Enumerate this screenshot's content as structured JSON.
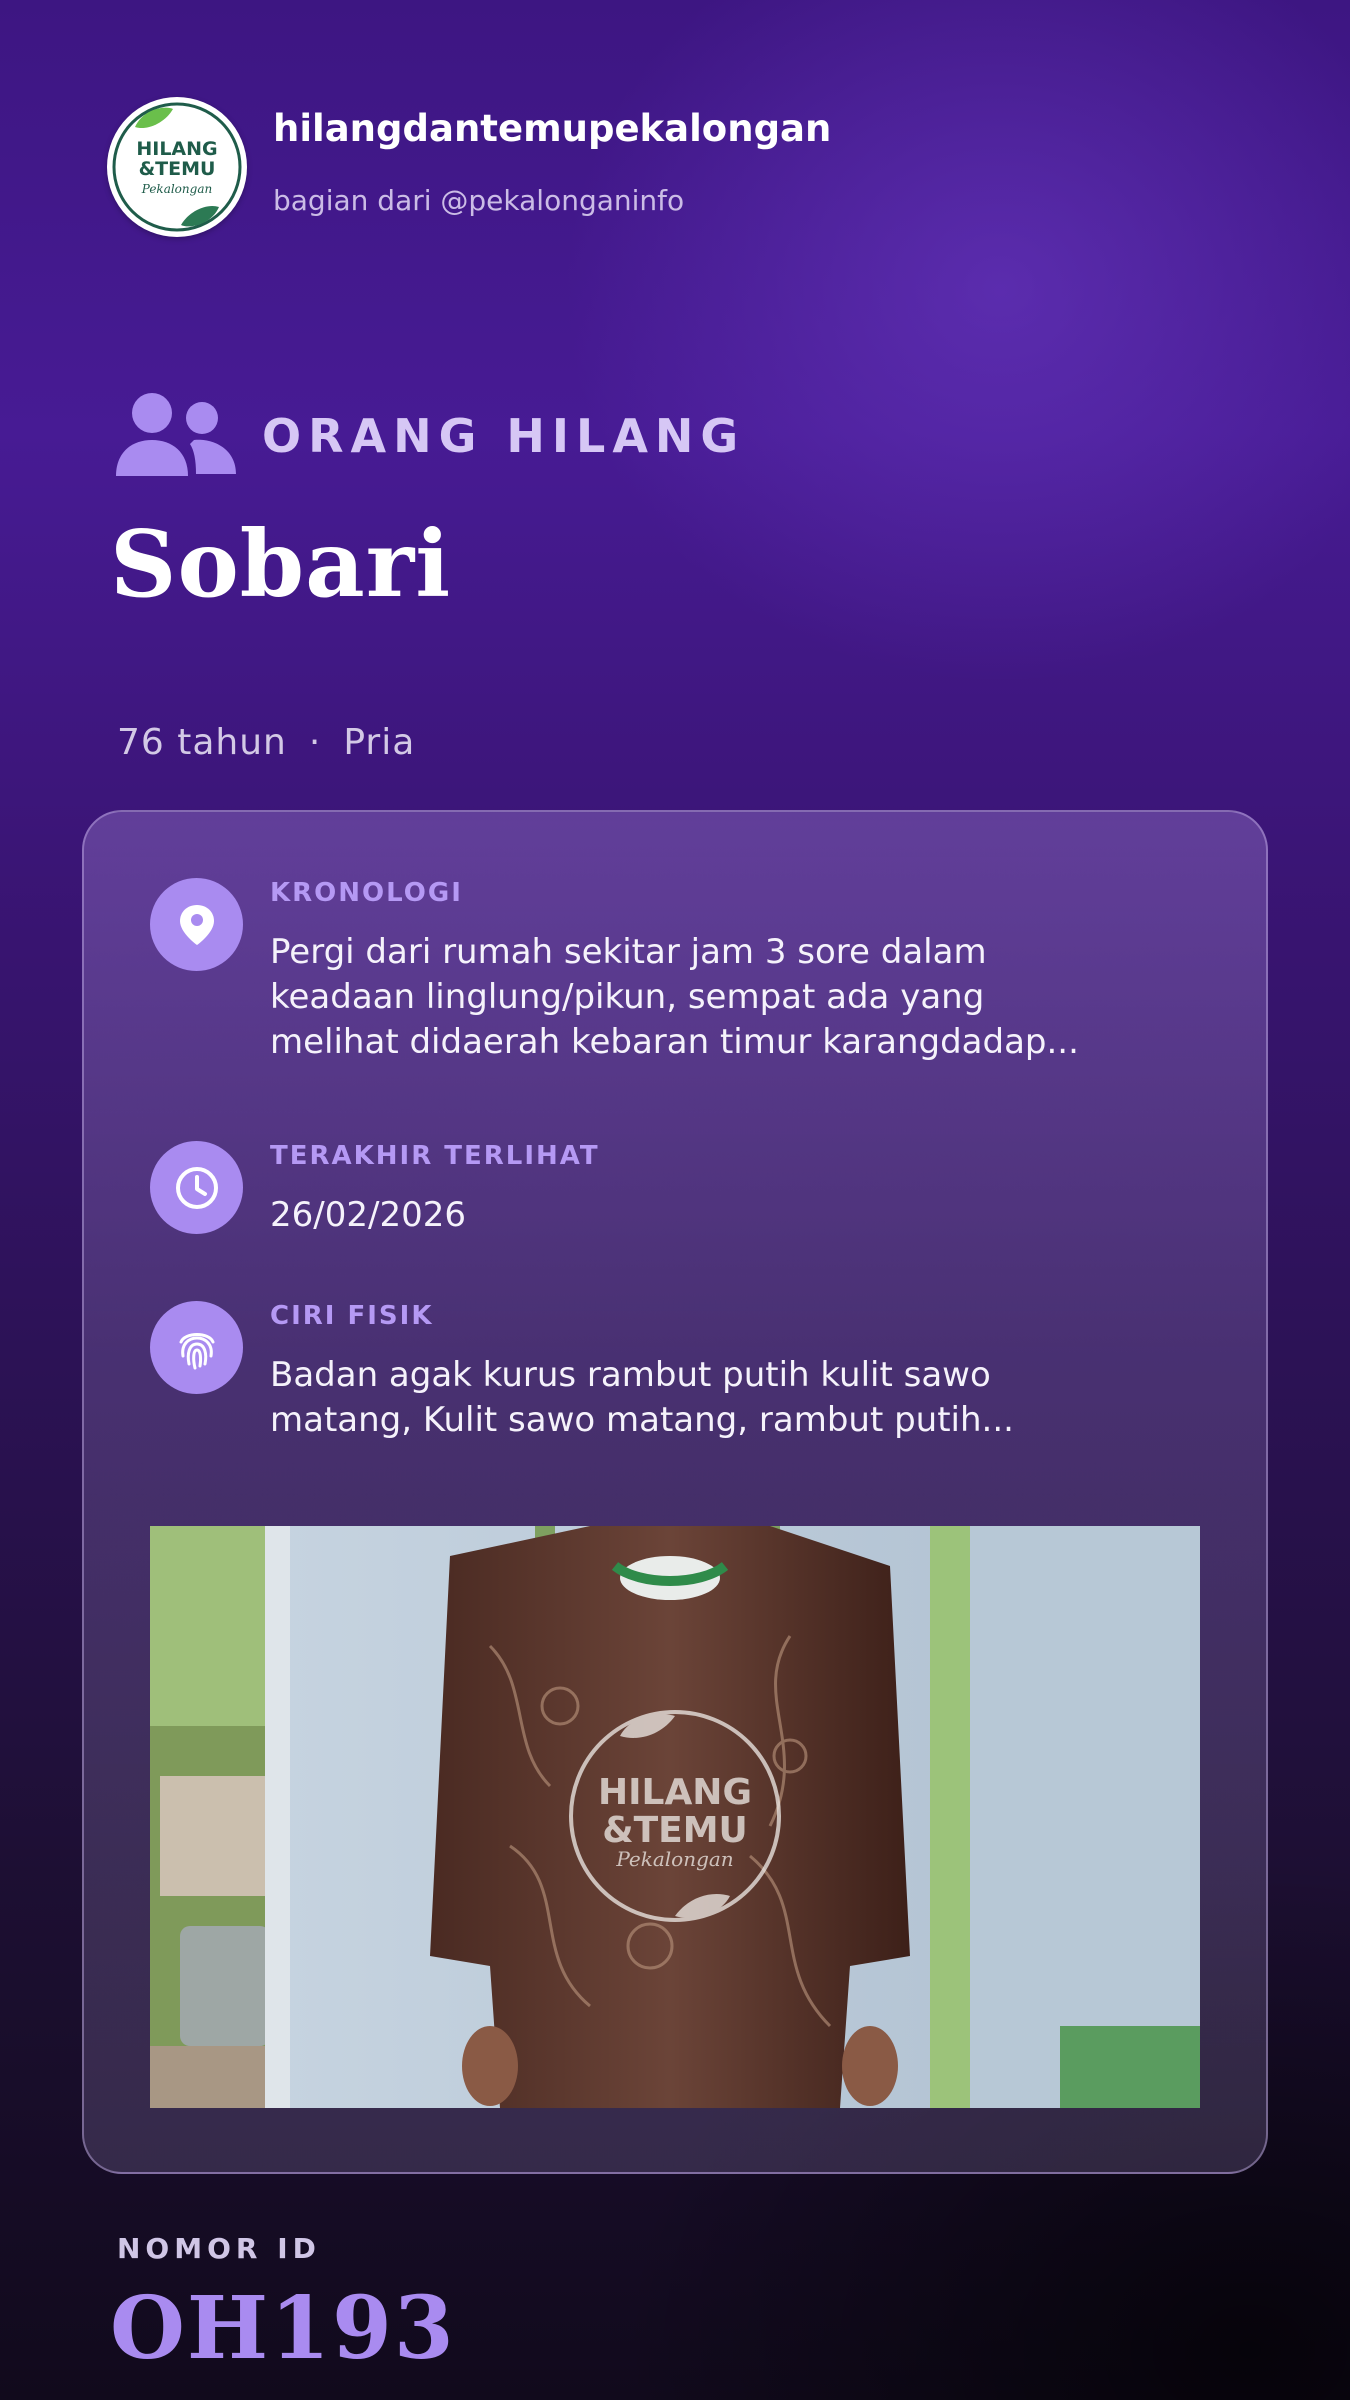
{
  "header": {
    "logo": {
      "line1": "HILANG",
      "line2": "&TEMU",
      "line3": "Pekalongan"
    },
    "account_name": "hilangdantemupekalongan",
    "account_sub": "bagian dari @pekalonganinfo"
  },
  "category": {
    "icon": "users-icon",
    "label": "ORANG HILANG"
  },
  "person": {
    "name": "Sobari",
    "age": "76 tahun",
    "separator": "·",
    "gender": "Pria"
  },
  "details": [
    {
      "icon": "map-pin-icon",
      "label": "KRONOLOGI",
      "value": "Pergi dari rumah sekitar jam 3 sore dalam keadaan linglung/pikun, sempat ada yang melihat didaerah kebaran timur karangdadap..."
    },
    {
      "icon": "clock-icon",
      "label": "TERAKHIR TERLIHAT",
      "value": "26/02/2026"
    },
    {
      "icon": "fingerprint-icon",
      "label": "CIRI FISIK",
      "value": "Badan agak kurus rambut putih kulit sawo matang, Kulit sawo matang, rambut putih..."
    }
  ],
  "photo": {
    "watermark_line1": "HILANG",
    "watermark_line2": "&TEMU",
    "watermark_line3": "Pekalongan"
  },
  "footer": {
    "id_label": "NOMOR ID",
    "id_value": "OH193"
  },
  "colors": {
    "accent": "#a98bf0",
    "label": "#b599f4",
    "logo_green": "#1f5c4a",
    "leaf_green": "#6abf4b"
  }
}
